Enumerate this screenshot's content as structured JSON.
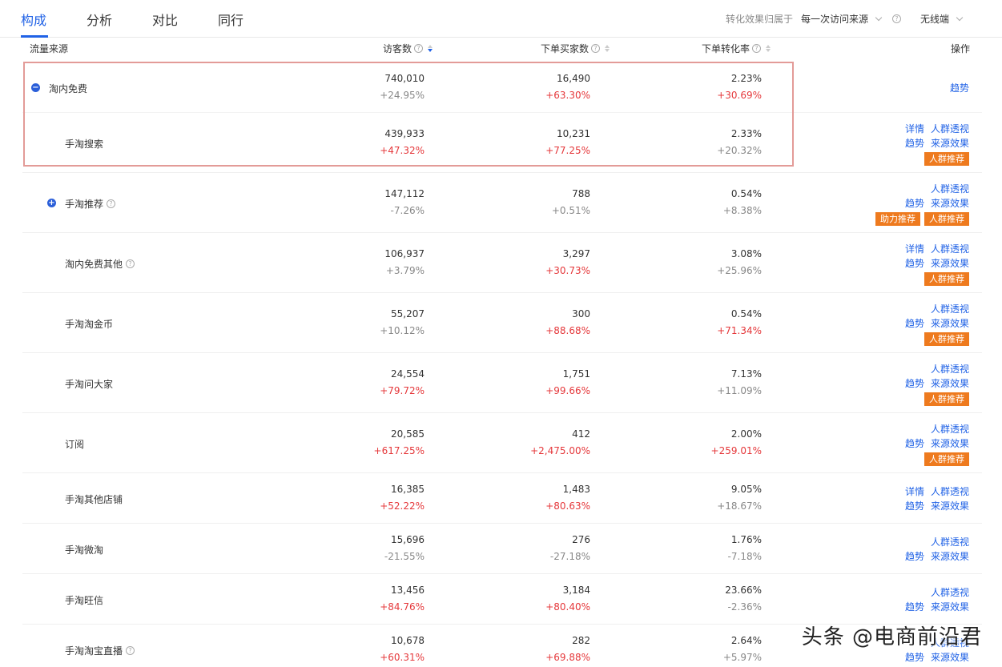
{
  "tabs": [
    {
      "label": "构成",
      "active": true
    },
    {
      "label": "分析",
      "active": false
    },
    {
      "label": "对比",
      "active": false
    },
    {
      "label": "同行",
      "active": false
    }
  ],
  "filters": {
    "attribution_label": "转化效果归属于",
    "attribution_value": "每一次访问来源",
    "device_value": "无线端"
  },
  "table": {
    "headers": {
      "source": "流量来源",
      "visitors": "访客数",
      "buyers": "下单买家数",
      "conversion": "下单转化率",
      "actions": "操作"
    },
    "rows": [
      {
        "source": "淘内免费",
        "toggle": "minus",
        "visitors": "740,010",
        "visitors_change": "+24.95%",
        "visitors_up": false,
        "buyers": "16,490",
        "buyers_change": "+63.30%",
        "buyers_up": true,
        "conversion": "2.23%",
        "conversion_change": "+30.69%",
        "conversion_up": true,
        "actions": {
          "lines": [
            [
              "趋势"
            ]
          ],
          "buttons": []
        }
      },
      {
        "source": "手淘搜索",
        "visitors": "439,933",
        "visitors_change": "+47.32%",
        "visitors_up": true,
        "buyers": "10,231",
        "buyers_change": "+77.25%",
        "buyers_up": true,
        "conversion": "2.33%",
        "conversion_change": "+20.32%",
        "conversion_up": false,
        "actions": {
          "lines": [
            [
              "详情",
              "人群透视"
            ],
            [
              "趋势",
              "来源效果"
            ]
          ],
          "buttons": [
            "人群推荐"
          ]
        }
      },
      {
        "source": "手淘推荐",
        "toggle": "plus",
        "help": true,
        "visitors": "147,112",
        "visitors_change": "-7.26%",
        "visitors_up": false,
        "buyers": "788",
        "buyers_change": "+0.51%",
        "buyers_up": false,
        "conversion": "0.54%",
        "conversion_change": "+8.38%",
        "conversion_up": false,
        "actions": {
          "lines": [
            [
              "人群透视"
            ],
            [
              "趋势",
              "来源效果"
            ]
          ],
          "buttons": [
            "助力推荐",
            "人群推荐"
          ]
        }
      },
      {
        "source": "淘内免费其他",
        "help": true,
        "visitors": "106,937",
        "visitors_change": "+3.79%",
        "visitors_up": false,
        "buyers": "3,297",
        "buyers_change": "+30.73%",
        "buyers_up": true,
        "conversion": "3.08%",
        "conversion_change": "+25.96%",
        "conversion_up": false,
        "actions": {
          "lines": [
            [
              "详情",
              "人群透视"
            ],
            [
              "趋势",
              "来源效果"
            ]
          ],
          "buttons": [
            "人群推荐"
          ]
        }
      },
      {
        "source": "手淘淘金币",
        "visitors": "55,207",
        "visitors_change": "+10.12%",
        "visitors_up": false,
        "buyers": "300",
        "buyers_change": "+88.68%",
        "buyers_up": true,
        "conversion": "0.54%",
        "conversion_change": "+71.34%",
        "conversion_up": true,
        "actions": {
          "lines": [
            [
              "人群透视"
            ],
            [
              "趋势",
              "来源效果"
            ]
          ],
          "buttons": [
            "人群推荐"
          ]
        }
      },
      {
        "source": "手淘问大家",
        "visitors": "24,554",
        "visitors_change": "+79.72%",
        "visitors_up": true,
        "buyers": "1,751",
        "buyers_change": "+99.66%",
        "buyers_up": true,
        "conversion": "7.13%",
        "conversion_change": "+11.09%",
        "conversion_up": false,
        "actions": {
          "lines": [
            [
              "人群透视"
            ],
            [
              "趋势",
              "来源效果"
            ]
          ],
          "buttons": [
            "人群推荐"
          ]
        }
      },
      {
        "source": "订阅",
        "visitors": "20,585",
        "visitors_change": "+617.25%",
        "visitors_up": true,
        "buyers": "412",
        "buyers_change": "+2,475.00%",
        "buyers_up": true,
        "conversion": "2.00%",
        "conversion_change": "+259.01%",
        "conversion_up": true,
        "actions": {
          "lines": [
            [
              "人群透视"
            ],
            [
              "趋势",
              "来源效果"
            ]
          ],
          "buttons": [
            "人群推荐"
          ]
        }
      },
      {
        "source": "手淘其他店铺",
        "visitors": "16,385",
        "visitors_change": "+52.22%",
        "visitors_up": true,
        "buyers": "1,483",
        "buyers_change": "+80.63%",
        "buyers_up": true,
        "conversion": "9.05%",
        "conversion_change": "+18.67%",
        "conversion_up": false,
        "actions": {
          "lines": [
            [
              "详情",
              "人群透视"
            ],
            [
              "趋势",
              "来源效果"
            ]
          ],
          "buttons": []
        }
      },
      {
        "source": "手淘微淘",
        "visitors": "15,696",
        "visitors_change": "-21.55%",
        "visitors_up": false,
        "buyers": "276",
        "buyers_change": "-27.18%",
        "buyers_up": false,
        "conversion": "1.76%",
        "conversion_change": "-7.18%",
        "conversion_up": false,
        "actions": {
          "lines": [
            [
              "人群透视"
            ],
            [
              "趋势",
              "来源效果"
            ]
          ],
          "buttons": []
        }
      },
      {
        "source": "手淘旺信",
        "visitors": "13,456",
        "visitors_change": "+84.76%",
        "visitors_up": true,
        "buyers": "3,184",
        "buyers_change": "+80.40%",
        "buyers_up": true,
        "conversion": "23.66%",
        "conversion_change": "-2.36%",
        "conversion_up": false,
        "actions": {
          "lines": [
            [
              "人群透视"
            ],
            [
              "趋势",
              "来源效果"
            ]
          ],
          "buttons": []
        }
      },
      {
        "source": "手淘淘宝直播",
        "help": true,
        "visitors": "10,678",
        "visitors_change": "+60.31%",
        "visitors_up": true,
        "buyers": "282",
        "buyers_change": "+69.88%",
        "buyers_up": true,
        "conversion": "2.64%",
        "conversion_change": "+5.97%",
        "conversion_up": false,
        "actions": {
          "lines": [
            [
              "人群透视"
            ],
            [
              "趋势",
              "来源效果"
            ]
          ],
          "buttons": []
        }
      }
    ]
  },
  "watermark": "头条 @电商前沿君",
  "colors": {
    "accent": "#2062e6",
    "up": "#e5383b",
    "button": "#ee7a1e",
    "highlight": "#e39b98"
  }
}
